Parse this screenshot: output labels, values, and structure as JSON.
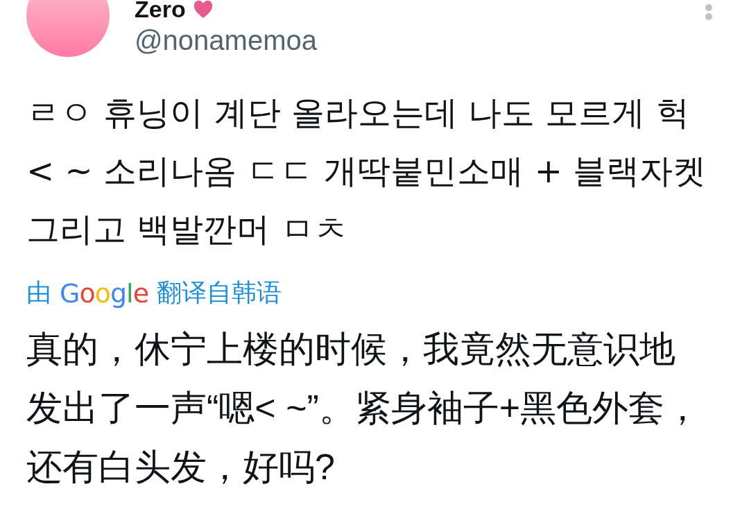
{
  "author": {
    "name": "Zero",
    "handle": "@nonamemoa"
  },
  "tweet": {
    "text": "ㄹㅇ 휴닝이 계단 올라오는데 나도 모르게 헉\n< ~ 소리나옴 ㄷㄷ 개딱붙민소매 + 블랙자켓\n그리고 백발깐머 ㅁㅊ"
  },
  "translation": {
    "prefix": "由",
    "provider": "Google",
    "suffix": "翻译自韩语",
    "text": "真的，休宁上楼的时候，我竟然无意识地发出了一声“嗯< ~”。紧身袖子+黑色外套，还有白头发，好吗?"
  }
}
